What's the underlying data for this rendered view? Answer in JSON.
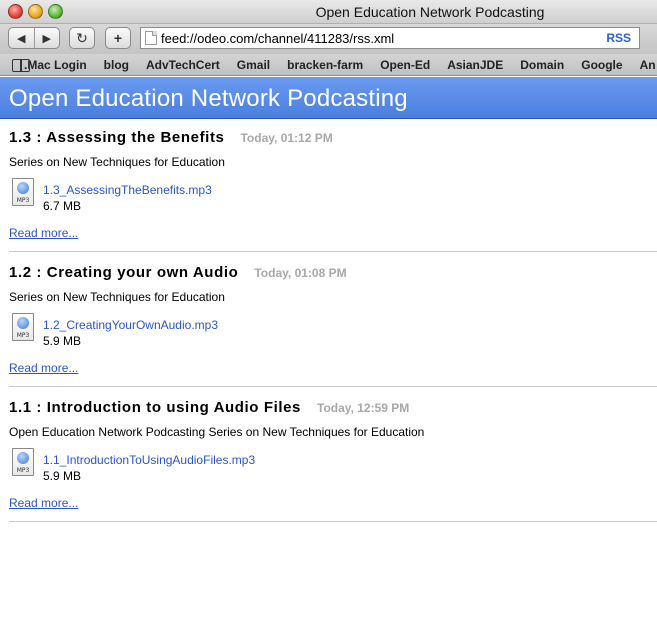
{
  "window": {
    "title": "Open Education Network Podcasting"
  },
  "toolbar": {
    "back_glyph": "◀",
    "forward_glyph": "▶",
    "reload_glyph": "↻",
    "add_glyph": "+",
    "url": "feed://odeo.com/channel/411283/rss.xml",
    "rss_label": "RSS"
  },
  "bookmarks": {
    "items": [
      ".Mac Login",
      "blog",
      "AdvTechCert",
      "Gmail",
      "bracken-farm",
      "Open-Ed",
      "AsianJDE",
      "Domain",
      "Google",
      "An"
    ]
  },
  "feed": {
    "title": "Open Education Network Podcasting",
    "accent_color": "#4a7fe0",
    "articles": [
      {
        "title": "1.3 : Assessing the Benefits",
        "date": "Today, 01:12 PM",
        "description": "Series on New Techniques for Education",
        "enclosure_name": "1.3_AssessingTheBenefits.mp3",
        "enclosure_size": "6.7 MB",
        "read_more": "Read more..."
      },
      {
        "title": "1.2 : Creating your own Audio",
        "date": "Today, 01:08 PM",
        "description": "Series on New Techniques for Education",
        "enclosure_name": "1.2_CreatingYourOwnAudio.mp3",
        "enclosure_size": "5.9 MB",
        "read_more": "Read more..."
      },
      {
        "title": "1.1 : Introduction to using Audio Files",
        "date": "Today, 12:59 PM",
        "description": "Open Education Network Podcasting Series on New Techniques for Education",
        "enclosure_name": "1.1_IntroductionToUsingAudioFiles.mp3",
        "enclosure_size": "5.9 MB",
        "read_more": "Read more..."
      }
    ]
  },
  "icons": {
    "file_icon_label": "MP3"
  }
}
